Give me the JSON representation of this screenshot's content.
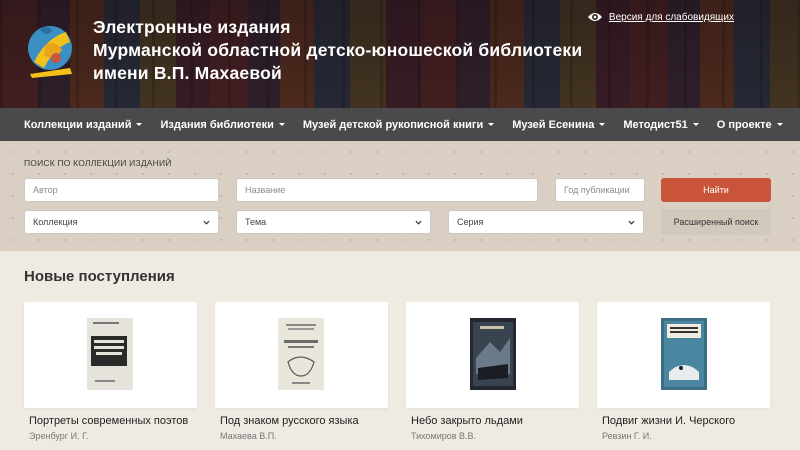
{
  "header": {
    "title_lines": [
      "Электронные издания",
      "Мурманской областной детско-юношеской библиотеки",
      "имени В.П. Махаевой"
    ],
    "accessibility_link": "Версия для слабовидящих",
    "logo_icon": "library-logo-icon"
  },
  "nav": {
    "items": [
      {
        "label": "Коллекции изданий"
      },
      {
        "label": "Издания библиотеки"
      },
      {
        "label": "Музей детской рукописной книги"
      },
      {
        "label": "Музей Есенина"
      },
      {
        "label": "Методист51"
      },
      {
        "label": "О проекте"
      }
    ]
  },
  "search": {
    "label": "ПОИСК ПО КОЛЛЕКЦИИ ИЗДАНИЙ",
    "author_placeholder": "Автор",
    "title_placeholder": "Название",
    "year_placeholder": "Год публикации",
    "find_button": "Найти",
    "collection_select": "Коллекция",
    "topic_select": "Тема",
    "series_select": "Серия",
    "advanced_button": "Расширенный поиск"
  },
  "new_arrivals": {
    "heading": "Новые поступления",
    "books": [
      {
        "title": "Портреты современных поэтов",
        "author": "Эренбург И. Г."
      },
      {
        "title": "Под знаком русского языка",
        "author": "Махаева В.П."
      },
      {
        "title": "Небо закрыто льдами",
        "author": "Тихомиров В.В."
      },
      {
        "title": "Подвиг жизни И. Черского",
        "author": "Ревзин Г. И."
      }
    ]
  },
  "colors": {
    "accent": "#c9543a",
    "nav_bg": "#4a4a4d",
    "page_bg": "#efebe3"
  }
}
